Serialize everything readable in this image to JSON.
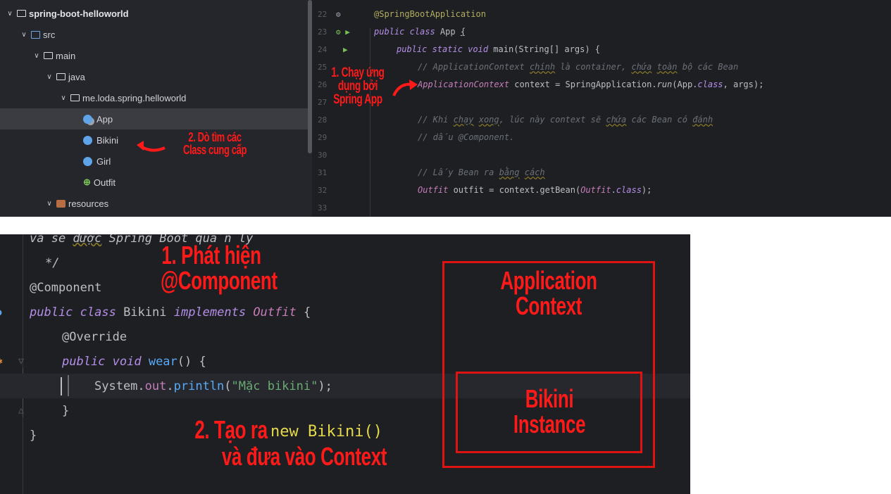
{
  "project_tree": {
    "items": [
      {
        "label": "spring-boot-helloworld",
        "icon": "folder-icon",
        "bold": true
      },
      {
        "label": "src",
        "icon": "source-folder-icon"
      },
      {
        "label": "main",
        "icon": "folder-icon"
      },
      {
        "label": "java",
        "icon": "folder-icon"
      },
      {
        "label": "me.loda.spring.helloworld",
        "icon": "folder-icon"
      },
      {
        "label": "App",
        "icon": "class-icon"
      },
      {
        "label": "Bikini",
        "icon": "class-icon"
      },
      {
        "label": "Girl",
        "icon": "class-icon"
      },
      {
        "label": "Outfit",
        "icon": "interface-icon"
      },
      {
        "label": "resources",
        "icon": "resources-folder-icon"
      }
    ]
  },
  "top_editor": {
    "line_numbers": [
      "22",
      "23",
      "24",
      "25",
      "26",
      "27",
      "28",
      "29",
      "30",
      "31",
      "32",
      "33"
    ],
    "lines": {
      "l22": "@SpringBootApplication",
      "l23a": "public class ",
      "l23b": "App ",
      "l23c": "{",
      "l24a": "public static void ",
      "l24b": "main",
      "l24c": "(String[] args) {",
      "l25a": "// ApplicationContext ",
      "l25b": "chính",
      "l25c": " là container, ",
      "l25d": "chứa",
      "l25e": " ",
      "l25f": "toàn",
      "l25g": " bộ các Bean",
      "l26a": "ApplicationContext ",
      "l26b": "context = SpringApplication.",
      "l26c": "run",
      "l26d": "(App.",
      "l26e": "class",
      "l26f": ", args);",
      "l28a": "// Khi ",
      "l28b": "chạy",
      "l28c": " ",
      "l28d": "xong",
      "l28e": ", lúc này context sẽ ",
      "l28f": "chứa",
      "l28g": " các Bean có ",
      "l28h": "đánh",
      "l29": "// dấu @Component.",
      "l31a": "// Lấy Bean ra ",
      "l31b": "bằng",
      "l31c": " ",
      "l31d": "cách",
      "l32a": "Outfit ",
      "l32b": "outfit = context.getBean(",
      "l32c": "Outfit",
      "l32d": ".",
      "l32e": "class",
      "l32f": ");"
    }
  },
  "annotations_top": {
    "run_app": [
      "1. Chạy ứng",
      "dụng bởi",
      "Spring App"
    ],
    "scan_classes": [
      "2. Dò tìm các",
      "Class cung cấp"
    ]
  },
  "bottom_editor": {
    "lines": {
      "b0a": "và sẽ ",
      "b0b": "được",
      "b0c": " Spring Boot quản lý",
      "b1": "*/",
      "b2": "@Component",
      "b3a": "public class ",
      "b3b": "Bikini ",
      "b3c": "implements ",
      "b3d": "Outfit",
      "b3e": " {",
      "b4": "@Override",
      "b5a": "public void ",
      "b5b": "wear",
      "b5c": "() {",
      "b6a": "System.",
      "b6b": "out",
      "b6c": ".",
      "b6d": "println",
      "b6e": "(",
      "b6f": "\"Mặc bikini\"",
      "b6g": ");",
      "b7": "}",
      "b8": "}"
    }
  },
  "annotations_bottom": {
    "detect": [
      "1. Phát hiện",
      "@Component"
    ],
    "create_prefix": "2. Tạo ra",
    "create_code": "new Bikini()",
    "create_suffix": "và đưa vào Context",
    "context_box": [
      "Application",
      "Context"
    ],
    "instance_box": [
      "Bikini",
      "Instance"
    ]
  },
  "colors": {
    "annotation_red": "#ff1a1a",
    "editor_bg": "#1e1f22",
    "keyword": "#b48ee8",
    "annotation": "#b3ae60"
  }
}
